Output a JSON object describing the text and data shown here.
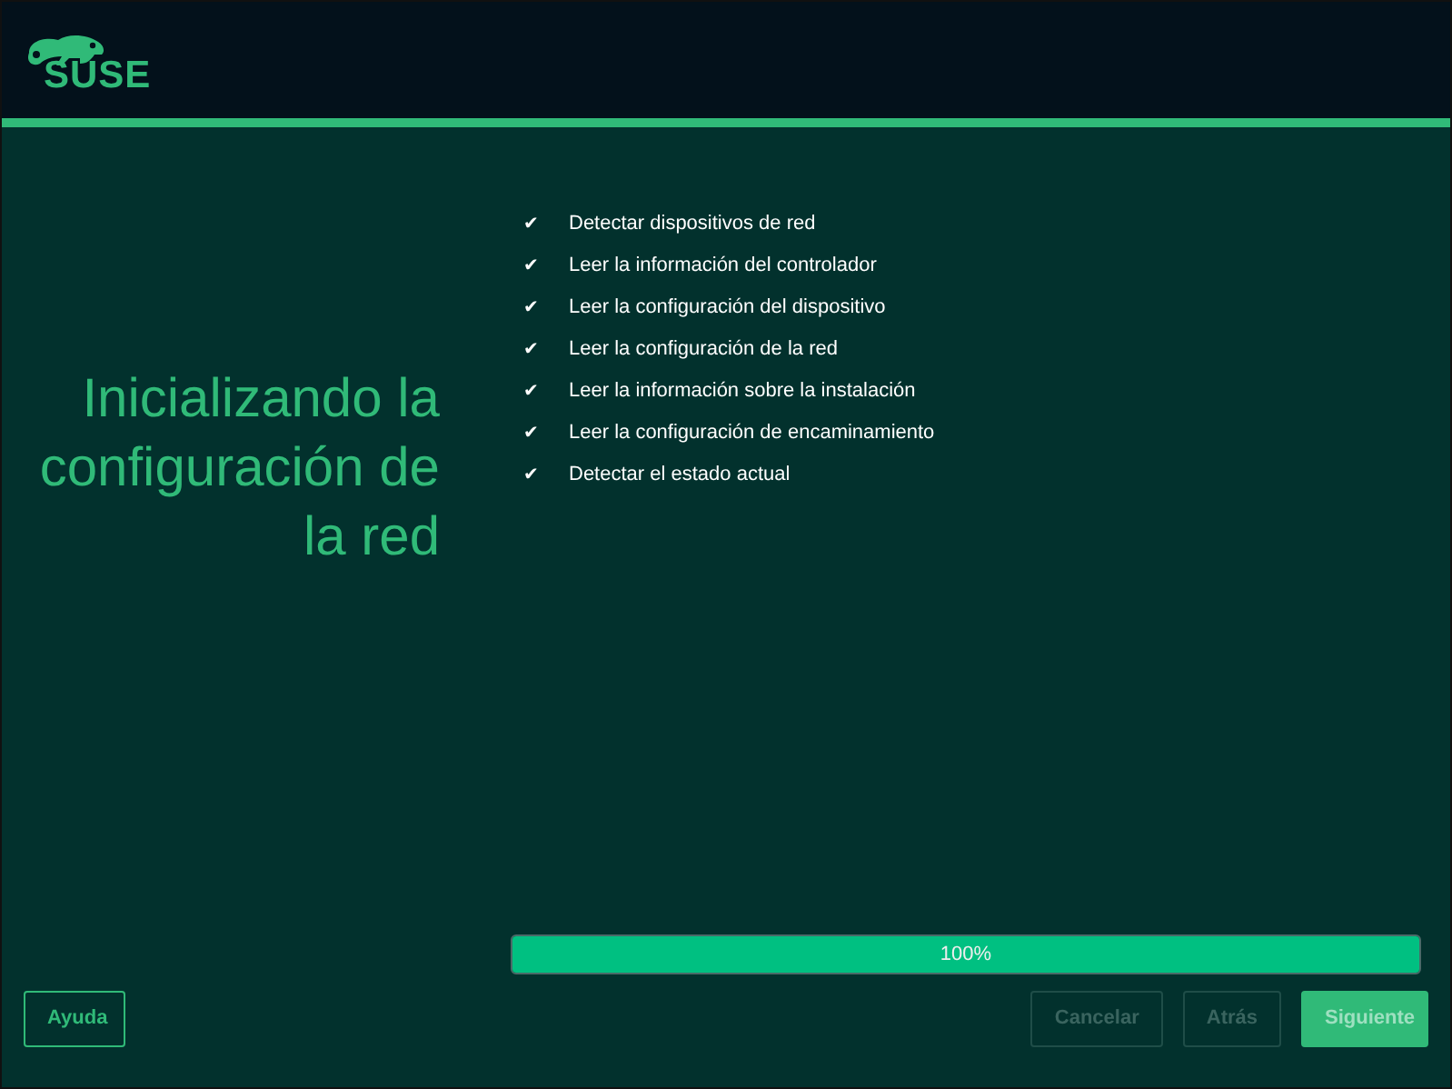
{
  "logo": {
    "text": "SUSE"
  },
  "title": "Inicializando la configuración de la red",
  "steps": [
    {
      "label": "Detectar dispositivos de red",
      "checked": true
    },
    {
      "label": "Leer la información del controlador",
      "checked": true
    },
    {
      "label": "Leer la configuración del dispositivo",
      "checked": true
    },
    {
      "label": "Leer la configuración de la red",
      "checked": true
    },
    {
      "label": "Leer la información sobre la instalación",
      "checked": true
    },
    {
      "label": "Leer la configuración de encaminamiento",
      "checked": true
    },
    {
      "label": "Detectar el estado actual",
      "checked": true
    }
  ],
  "check_mark": "✔",
  "progress": {
    "level": 1,
    "reading": "100%"
  },
  "buttons": [
    {
      "label": "Ayuda",
      "kind": "outline",
      "disabled": false
    },
    {
      "label": "Cancelar",
      "kind": "plain",
      "disabled": true
    },
    {
      "label": "Atrás",
      "kind": "plain",
      "disabled": true
    },
    {
      "label": "Siguiente",
      "kind": "primary",
      "disabled": false
    }
  ]
}
